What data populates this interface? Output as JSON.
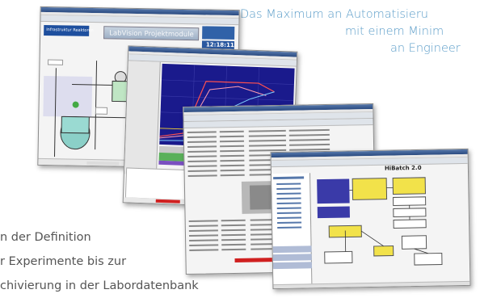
{
  "tagline": {
    "line1": "Das Maximum an Automatisieru",
    "line2": "mit einem Minim",
    "line3": "an Engineer"
  },
  "bottom_text": {
    "line1": "n der Definition",
    "line2": "r Experimente bis zur",
    "line3": "chivierung in der Labordatenbank"
  },
  "windows": {
    "process": {
      "header_label": "Infrastruktur Reaktoren",
      "banner": "LabVision Projektmodule",
      "clock": "12:18:11"
    },
    "hitec": {
      "title": "HiBatch 2.0"
    }
  },
  "colors": {
    "accent_blue": "#5a9cc8",
    "titlebar": "#2a4a80",
    "chart_bg": "#1a1a8c",
    "red_status": "#d02020",
    "yellow_block": "#f2e24a"
  }
}
